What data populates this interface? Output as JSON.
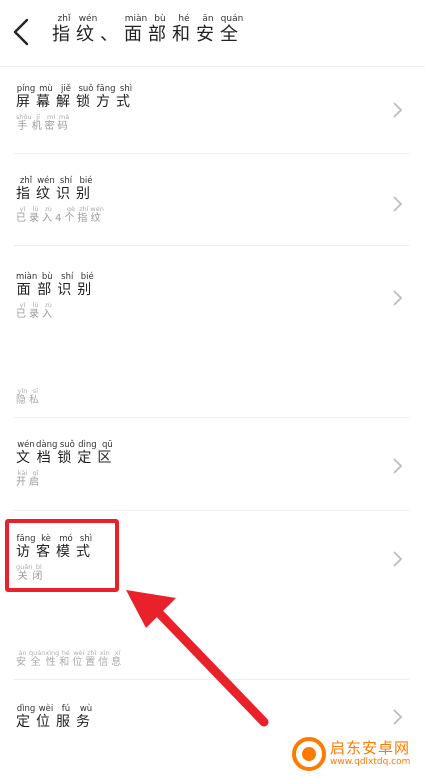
{
  "header": {
    "title": [
      {
        "ch": "指",
        "py": "zhǐ"
      },
      {
        "ch": "纹",
        "py": "wén"
      },
      {
        "ch": "、",
        "py": ""
      },
      {
        "ch": "面",
        "py": "miàn"
      },
      {
        "ch": "部",
        "py": "bù"
      },
      {
        "ch": "和",
        "py": "hé"
      },
      {
        "ch": "安",
        "py": "ān"
      },
      {
        "ch": "全",
        "py": "quán"
      }
    ]
  },
  "rows": [
    {
      "title": [
        {
          "ch": "屏",
          "py": "píng"
        },
        {
          "ch": "幕",
          "py": "mù"
        },
        {
          "ch": "解",
          "py": "jiě"
        },
        {
          "ch": "锁",
          "py": "suǒ"
        },
        {
          "ch": "方",
          "py": "fāng"
        },
        {
          "ch": "式",
          "py": "shì"
        }
      ],
      "sub": [
        {
          "ch": "手",
          "py": "shǒu"
        },
        {
          "ch": "机",
          "py": "jī"
        },
        {
          "ch": "密",
          "py": "mì"
        },
        {
          "ch": "码",
          "py": "mǎ"
        }
      ]
    },
    {
      "title": [
        {
          "ch": "指",
          "py": "zhǐ"
        },
        {
          "ch": "纹",
          "py": "wén"
        },
        {
          "ch": "识",
          "py": "shí"
        },
        {
          "ch": "别",
          "py": "bié"
        }
      ],
      "sub": [
        {
          "ch": "已",
          "py": "yǐ"
        },
        {
          "ch": "录",
          "py": "lù"
        },
        {
          "ch": "入",
          "py": "rù"
        },
        {
          "ch": "4",
          "py": ""
        },
        {
          "ch": "个",
          "py": "gè"
        },
        {
          "ch": "指",
          "py": "zhǐ"
        },
        {
          "ch": "纹",
          "py": "wén"
        }
      ]
    },
    {
      "title": [
        {
          "ch": "面",
          "py": "miàn"
        },
        {
          "ch": "部",
          "py": "bù"
        },
        {
          "ch": "识",
          "py": "shí"
        },
        {
          "ch": "别",
          "py": "bié"
        }
      ],
      "sub": [
        {
          "ch": "已",
          "py": "yǐ"
        },
        {
          "ch": "录",
          "py": "lù"
        },
        {
          "ch": "入",
          "py": "rù"
        }
      ]
    }
  ],
  "section_privacy": [
    {
      "ch": "隐",
      "py": "yǐn"
    },
    {
      "ch": "私",
      "py": "sī"
    }
  ],
  "rows2": [
    {
      "title": [
        {
          "ch": "文",
          "py": "wén"
        },
        {
          "ch": "档",
          "py": "dàng"
        },
        {
          "ch": "锁",
          "py": "suǒ"
        },
        {
          "ch": "定",
          "py": "dìng"
        },
        {
          "ch": "区",
          "py": "qū"
        }
      ],
      "sub": [
        {
          "ch": "开",
          "py": "kāi"
        },
        {
          "ch": "启",
          "py": "qǐ"
        }
      ]
    },
    {
      "title": [
        {
          "ch": "访",
          "py": "fǎng"
        },
        {
          "ch": "客",
          "py": "kè"
        },
        {
          "ch": "模",
          "py": "mó"
        },
        {
          "ch": "式",
          "py": "shì"
        }
      ],
      "sub": [
        {
          "ch": "关",
          "py": "guān"
        },
        {
          "ch": "闭",
          "py": "bì"
        }
      ]
    }
  ],
  "section_security": [
    {
      "ch": "安",
      "py": "ān"
    },
    {
      "ch": "全",
      "py": "quán"
    },
    {
      "ch": "性",
      "py": "xìng"
    },
    {
      "ch": "和",
      "py": "hé"
    },
    {
      "ch": "位",
      "py": "wèi"
    },
    {
      "ch": "置",
      "py": "zhì"
    },
    {
      "ch": "信",
      "py": "xìn"
    },
    {
      "ch": "息",
      "py": "xī"
    }
  ],
  "rows3": [
    {
      "title": [
        {
          "ch": "定",
          "py": "dìng"
        },
        {
          "ch": "位",
          "py": "wèi"
        },
        {
          "ch": "服",
          "py": "fú"
        },
        {
          "ch": "务",
          "py": "wù"
        }
      ]
    }
  ],
  "watermark": {
    "brand": "启东安卓网",
    "url": "www.qdlxtdq.com"
  },
  "colors": {
    "highlight": "#e8212b",
    "watermark": "#ff7a00",
    "divider": "#eeeeee",
    "subtext": "#9a9a9a"
  }
}
